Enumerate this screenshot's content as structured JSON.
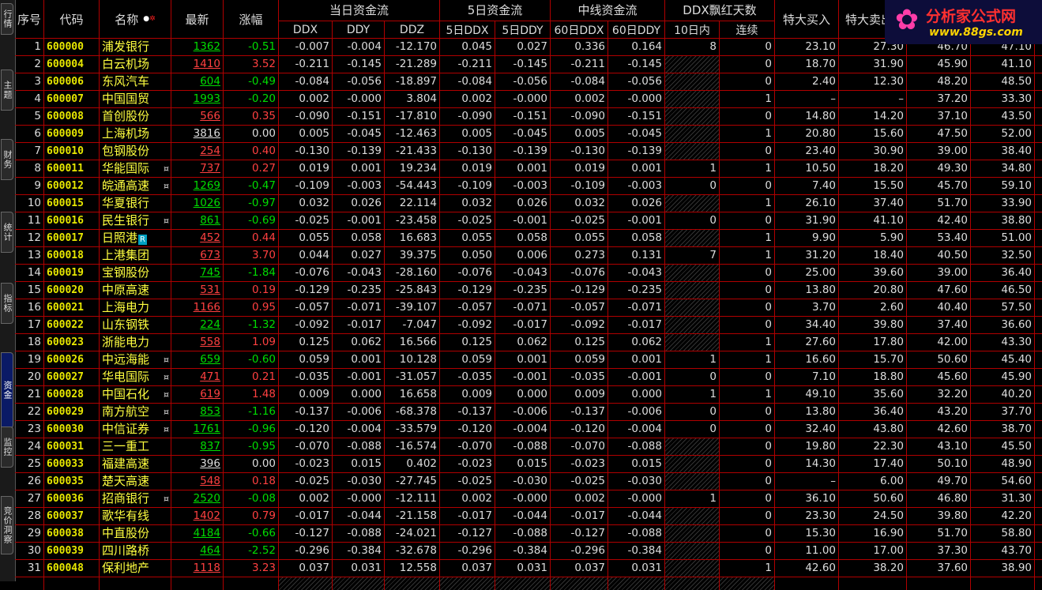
{
  "sidebar": {
    "tabs": [
      {
        "label": "行情",
        "active": false
      },
      {
        "label": "主题",
        "active": false
      },
      {
        "label": "财务",
        "active": false
      },
      {
        "label": "统计",
        "active": false
      },
      {
        "label": "指标",
        "active": false
      },
      {
        "label": "资金",
        "active": true
      },
      {
        "label": "监控",
        "active": false
      },
      {
        "label": "竞价洞察",
        "active": false
      }
    ]
  },
  "header": {
    "seq": "序号",
    "code": "代码",
    "name": "名称",
    "latest": "最新",
    "change": "涨幅",
    "group_today": "当日资金流",
    "group_5d": "5日资金流",
    "group_mid": "中线资金流",
    "group_red": "DDX飘红天数",
    "big_buy": "特大买入",
    "big_sell": "特大卖出",
    "ddx": "DDX",
    "ddy": "DDY",
    "ddz": "DDZ",
    "ddx5": "5日DDX",
    "ddy5": "5日DDY",
    "ddx60": "60日DDX",
    "ddy60": "60日DDY",
    "red10": "10日内",
    "streak": "连续"
  },
  "logo": {
    "title": "分析家公式网",
    "url": "www.88gs.com"
  },
  "colors": {
    "grid": "#b00000",
    "up": "#ff4040",
    "down": "#00dd00",
    "code": "#e8e800",
    "name": "#ffff40"
  },
  "rows": [
    {
      "seq": "1",
      "code": "600000",
      "name": "浦发银行",
      "sym": "",
      "price": "1362",
      "change": "-0.51",
      "ddx": "-0.007",
      "ddy": "-0.004",
      "ddz": "-12.170",
      "ddx5": "0.045",
      "ddy5": "0.027",
      "ddx60": "0.336",
      "ddy60": "0.164",
      "red10": "8",
      "streak": "0",
      "buy": "23.10",
      "sell": "27.30",
      "c1": "46.70",
      "c2": "47.10"
    },
    {
      "seq": "2",
      "code": "600004",
      "name": "白云机场",
      "sym": "",
      "price": "1410",
      "change": "3.52",
      "ddx": "-0.211",
      "ddy": "-0.145",
      "ddz": "-21.289",
      "ddx5": "-0.211",
      "ddy5": "-0.145",
      "ddx60": "-0.211",
      "ddy60": "-0.145",
      "red10": "",
      "streak": "0",
      "buy": "18.70",
      "sell": "31.90",
      "c1": "45.90",
      "c2": "41.10"
    },
    {
      "seq": "3",
      "code": "600006",
      "name": "东风汽车",
      "sym": "",
      "price": "604",
      "change": "-0.49",
      "ddx": "-0.084",
      "ddy": "-0.056",
      "ddz": "-18.897",
      "ddx5": "-0.084",
      "ddy5": "-0.056",
      "ddx60": "-0.084",
      "ddy60": "-0.056",
      "red10": "",
      "streak": "0",
      "buy": "2.40",
      "sell": "12.30",
      "c1": "48.20",
      "c2": "48.50"
    },
    {
      "seq": "4",
      "code": "600007",
      "name": "中国国贸",
      "sym": "",
      "price": "1993",
      "change": "-0.20",
      "ddx": "0.002",
      "ddy": "-0.000",
      "ddz": "3.804",
      "ddx5": "0.002",
      "ddy5": "-0.000",
      "ddx60": "0.002",
      "ddy60": "-0.000",
      "red10": "",
      "streak": "1",
      "buy": "–",
      "sell": "–",
      "c1": "37.20",
      "c2": "33.30"
    },
    {
      "seq": "5",
      "code": "600008",
      "name": "首创股份",
      "sym": "",
      "price": "566",
      "change": "0.35",
      "ddx": "-0.090",
      "ddy": "-0.151",
      "ddz": "-17.810",
      "ddx5": "-0.090",
      "ddy5": "-0.151",
      "ddx60": "-0.090",
      "ddy60": "-0.151",
      "red10": "",
      "streak": "0",
      "buy": "14.80",
      "sell": "14.20",
      "c1": "37.10",
      "c2": "43.50"
    },
    {
      "seq": "6",
      "code": "600009",
      "name": "上海机场",
      "sym": "",
      "price": "3816",
      "change": "0.00",
      "ddx": "0.005",
      "ddy": "-0.045",
      "ddz": "-12.463",
      "ddx5": "0.005",
      "ddy5": "-0.045",
      "ddx60": "0.005",
      "ddy60": "-0.045",
      "red10": "",
      "streak": "1",
      "buy": "20.80",
      "sell": "15.60",
      "c1": "47.50",
      "c2": "52.00"
    },
    {
      "seq": "7",
      "code": "600010",
      "name": "包钢股份",
      "sym": "",
      "price": "254",
      "change": "0.40",
      "ddx": "-0.130",
      "ddy": "-0.139",
      "ddz": "-21.433",
      "ddx5": "-0.130",
      "ddy5": "-0.139",
      "ddx60": "-0.130",
      "ddy60": "-0.139",
      "red10": "",
      "streak": "0",
      "buy": "23.40",
      "sell": "30.90",
      "c1": "39.00",
      "c2": "38.40"
    },
    {
      "seq": "8",
      "code": "600011",
      "name": "华能国际",
      "sym": "¤",
      "price": "737",
      "change": "0.27",
      "ddx": "0.019",
      "ddy": "0.001",
      "ddz": "19.234",
      "ddx5": "0.019",
      "ddy5": "0.001",
      "ddx60": "0.019",
      "ddy60": "0.001",
      "red10": "1",
      "streak": "1",
      "buy": "10.50",
      "sell": "18.20",
      "c1": "49.30",
      "c2": "34.80"
    },
    {
      "seq": "9",
      "code": "600012",
      "name": "皖通高速",
      "sym": "¤",
      "price": "1269",
      "change": "-0.47",
      "ddx": "-0.109",
      "ddy": "-0.003",
      "ddz": "-54.443",
      "ddx5": "-0.109",
      "ddy5": "-0.003",
      "ddx60": "-0.109",
      "ddy60": "-0.003",
      "red10": "0",
      "streak": "0",
      "buy": "7.40",
      "sell": "15.50",
      "c1": "45.70",
      "c2": "59.10"
    },
    {
      "seq": "10",
      "code": "600015",
      "name": "华夏银行",
      "sym": "",
      "price": "1026",
      "change": "-0.97",
      "ddx": "0.032",
      "ddy": "0.026",
      "ddz": "22.114",
      "ddx5": "0.032",
      "ddy5": "0.026",
      "ddx60": "0.032",
      "ddy60": "0.026",
      "red10": "",
      "streak": "1",
      "buy": "26.10",
      "sell": "37.40",
      "c1": "51.70",
      "c2": "33.90"
    },
    {
      "seq": "11",
      "code": "600016",
      "name": "民生银行",
      "sym": "¤",
      "price": "861",
      "change": "-0.69",
      "ddx": "-0.025",
      "ddy": "-0.001",
      "ddz": "-23.458",
      "ddx5": "-0.025",
      "ddy5": "-0.001",
      "ddx60": "-0.025",
      "ddy60": "-0.001",
      "red10": "0",
      "streak": "0",
      "buy": "31.90",
      "sell": "41.10",
      "c1": "42.40",
      "c2": "38.80"
    },
    {
      "seq": "12",
      "code": "600017",
      "name": "日照港",
      "sym": "R",
      "price": "452",
      "change": "0.44",
      "ddx": "0.055",
      "ddy": "0.058",
      "ddz": "16.683",
      "ddx5": "0.055",
      "ddy5": "0.058",
      "ddx60": "0.055",
      "ddy60": "0.058",
      "red10": "",
      "streak": "1",
      "buy": "9.90",
      "sell": "5.90",
      "c1": "53.40",
      "c2": "51.00"
    },
    {
      "seq": "13",
      "code": "600018",
      "name": "上港集团",
      "sym": "",
      "price": "673",
      "change": "3.70",
      "ddx": "0.044",
      "ddy": "0.027",
      "ddz": "39.375",
      "ddx5": "0.050",
      "ddy5": "0.006",
      "ddx60": "0.273",
      "ddy60": "0.131",
      "red10": "7",
      "streak": "1",
      "buy": "31.20",
      "sell": "18.40",
      "c1": "40.50",
      "c2": "32.50"
    },
    {
      "seq": "14",
      "code": "600019",
      "name": "宝钢股份",
      "sym": "",
      "price": "745",
      "change": "-1.84",
      "ddx": "-0.076",
      "ddy": "-0.043",
      "ddz": "-28.160",
      "ddx5": "-0.076",
      "ddy5": "-0.043",
      "ddx60": "-0.076",
      "ddy60": "-0.043",
      "red10": "",
      "streak": "0",
      "buy": "25.00",
      "sell": "39.60",
      "c1": "39.00",
      "c2": "36.40"
    },
    {
      "seq": "15",
      "code": "600020",
      "name": "中原高速",
      "sym": "",
      "price": "531",
      "change": "0.19",
      "ddx": "-0.129",
      "ddy": "-0.235",
      "ddz": "-25.843",
      "ddx5": "-0.129",
      "ddy5": "-0.235",
      "ddx60": "-0.129",
      "ddy60": "-0.235",
      "red10": "",
      "streak": "0",
      "buy": "13.80",
      "sell": "20.80",
      "c1": "47.60",
      "c2": "46.50"
    },
    {
      "seq": "16",
      "code": "600021",
      "name": "上海电力",
      "sym": "",
      "price": "1166",
      "change": "0.95",
      "ddx": "-0.057",
      "ddy": "-0.071",
      "ddz": "-39.107",
      "ddx5": "-0.057",
      "ddy5": "-0.071",
      "ddx60": "-0.057",
      "ddy60": "-0.071",
      "red10": "",
      "streak": "0",
      "buy": "3.70",
      "sell": "2.60",
      "c1": "40.40",
      "c2": "57.50"
    },
    {
      "seq": "17",
      "code": "600022",
      "name": "山东钢铁",
      "sym": "",
      "price": "224",
      "change": "-1.32",
      "ddx": "-0.092",
      "ddy": "-0.017",
      "ddz": "-7.047",
      "ddx5": "-0.092",
      "ddy5": "-0.017",
      "ddx60": "-0.092",
      "ddy60": "-0.017",
      "red10": "",
      "streak": "0",
      "buy": "34.40",
      "sell": "39.80",
      "c1": "37.40",
      "c2": "36.60"
    },
    {
      "seq": "18",
      "code": "600023",
      "name": "浙能电力",
      "sym": "",
      "price": "558",
      "change": "1.09",
      "ddx": "0.125",
      "ddy": "0.062",
      "ddz": "16.566",
      "ddx5": "0.125",
      "ddy5": "0.062",
      "ddx60": "0.125",
      "ddy60": "0.062",
      "red10": "",
      "streak": "1",
      "buy": "27.60",
      "sell": "17.80",
      "c1": "42.00",
      "c2": "43.30"
    },
    {
      "seq": "19",
      "code": "600026",
      "name": "中远海能",
      "sym": "¤",
      "price": "659",
      "change": "-0.60",
      "ddx": "0.059",
      "ddy": "0.001",
      "ddz": "10.128",
      "ddx5": "0.059",
      "ddy5": "0.001",
      "ddx60": "0.059",
      "ddy60": "0.001",
      "red10": "1",
      "streak": "1",
      "buy": "16.60",
      "sell": "15.70",
      "c1": "50.60",
      "c2": "45.40"
    },
    {
      "seq": "20",
      "code": "600027",
      "name": "华电国际",
      "sym": "¤",
      "price": "471",
      "change": "0.21",
      "ddx": "-0.035",
      "ddy": "-0.001",
      "ddz": "-31.057",
      "ddx5": "-0.035",
      "ddy5": "-0.001",
      "ddx60": "-0.035",
      "ddy60": "-0.001",
      "red10": "0",
      "streak": "0",
      "buy": "7.10",
      "sell": "18.80",
      "c1": "45.60",
      "c2": "45.90"
    },
    {
      "seq": "21",
      "code": "600028",
      "name": "中国石化",
      "sym": "¤",
      "price": "619",
      "change": "1.48",
      "ddx": "0.009",
      "ddy": "0.000",
      "ddz": "16.658",
      "ddx5": "0.009",
      "ddy5": "0.000",
      "ddx60": "0.009",
      "ddy60": "0.000",
      "red10": "1",
      "streak": "1",
      "buy": "49.10",
      "sell": "35.60",
      "c1": "32.20",
      "c2": "40.20"
    },
    {
      "seq": "22",
      "code": "600029",
      "name": "南方航空",
      "sym": "¤",
      "price": "853",
      "change": "-1.16",
      "ddx": "-0.137",
      "ddy": "-0.006",
      "ddz": "-68.378",
      "ddx5": "-0.137",
      "ddy5": "-0.006",
      "ddx60": "-0.137",
      "ddy60": "-0.006",
      "red10": "0",
      "streak": "0",
      "buy": "13.80",
      "sell": "36.40",
      "c1": "43.20",
      "c2": "37.70"
    },
    {
      "seq": "23",
      "code": "600030",
      "name": "中信证券",
      "sym": "¤",
      "price": "1761",
      "change": "-0.96",
      "ddx": "-0.120",
      "ddy": "-0.004",
      "ddz": "-33.579",
      "ddx5": "-0.120",
      "ddy5": "-0.004",
      "ddx60": "-0.120",
      "ddy60": "-0.004",
      "red10": "0",
      "streak": "0",
      "buy": "32.40",
      "sell": "43.80",
      "c1": "42.60",
      "c2": "38.70"
    },
    {
      "seq": "24",
      "code": "600031",
      "name": "三一重工",
      "sym": "",
      "price": "837",
      "change": "-0.95",
      "ddx": "-0.070",
      "ddy": "-0.088",
      "ddz": "-16.574",
      "ddx5": "-0.070",
      "ddy5": "-0.088",
      "ddx60": "-0.070",
      "ddy60": "-0.088",
      "red10": "",
      "streak": "0",
      "buy": "19.80",
      "sell": "22.30",
      "c1": "43.10",
      "c2": "45.50"
    },
    {
      "seq": "25",
      "code": "600033",
      "name": "福建高速",
      "sym": "",
      "price": "396",
      "change": "0.00",
      "ddx": "-0.023",
      "ddy": "0.015",
      "ddz": "0.402",
      "ddx5": "-0.023",
      "ddy5": "0.015",
      "ddx60": "-0.023",
      "ddy60": "0.015",
      "red10": "",
      "streak": "0",
      "buy": "14.30",
      "sell": "17.40",
      "c1": "50.10",
      "c2": "48.90"
    },
    {
      "seq": "26",
      "code": "600035",
      "name": "楚天高速",
      "sym": "",
      "price": "548",
      "change": "0.18",
      "ddx": "-0.025",
      "ddy": "-0.030",
      "ddz": "-27.745",
      "ddx5": "-0.025",
      "ddy5": "-0.030",
      "ddx60": "-0.025",
      "ddy60": "-0.030",
      "red10": "",
      "streak": "0",
      "buy": "–",
      "sell": "6.00",
      "c1": "49.70",
      "c2": "54.60"
    },
    {
      "seq": "27",
      "code": "600036",
      "name": "招商银行",
      "sym": "¤",
      "price": "2520",
      "change": "-0.08",
      "ddx": "0.002",
      "ddy": "-0.000",
      "ddz": "-12.111",
      "ddx5": "0.002",
      "ddy5": "-0.000",
      "ddx60": "0.002",
      "ddy60": "-0.000",
      "red10": "1",
      "streak": "0",
      "buy": "36.10",
      "sell": "50.60",
      "c1": "46.80",
      "c2": "31.30"
    },
    {
      "seq": "28",
      "code": "600037",
      "name": "歌华有线",
      "sym": "",
      "price": "1402",
      "change": "0.79",
      "ddx": "-0.017",
      "ddy": "-0.044",
      "ddz": "-21.158",
      "ddx5": "-0.017",
      "ddy5": "-0.044",
      "ddx60": "-0.017",
      "ddy60": "-0.044",
      "red10": "",
      "streak": "0",
      "buy": "23.30",
      "sell": "24.50",
      "c1": "39.80",
      "c2": "42.20"
    },
    {
      "seq": "29",
      "code": "600038",
      "name": "中直股份",
      "sym": "",
      "price": "4184",
      "change": "-0.66",
      "ddx": "-0.127",
      "ddy": "-0.088",
      "ddz": "-24.021",
      "ddx5": "-0.127",
      "ddy5": "-0.088",
      "ddx60": "-0.127",
      "ddy60": "-0.088",
      "red10": "",
      "streak": "0",
      "buy": "15.30",
      "sell": "16.90",
      "c1": "51.70",
      "c2": "58.80"
    },
    {
      "seq": "30",
      "code": "600039",
      "name": "四川路桥",
      "sym": "",
      "price": "464",
      "change": "-2.52",
      "ddx": "-0.296",
      "ddy": "-0.384",
      "ddz": "-32.678",
      "ddx5": "-0.296",
      "ddy5": "-0.384",
      "ddx60": "-0.296",
      "ddy60": "-0.384",
      "red10": "",
      "streak": "0",
      "buy": "11.00",
      "sell": "17.00",
      "c1": "37.30",
      "c2": "43.70"
    },
    {
      "seq": "31",
      "code": "600048",
      "name": "保利地产",
      "sym": "",
      "price": "1118",
      "change": "3.23",
      "ddx": "0.037",
      "ddy": "0.031",
      "ddz": "12.558",
      "ddx5": "0.037",
      "ddy5": "0.031",
      "ddx60": "0.037",
      "ddy60": "0.031",
      "red10": "",
      "streak": "1",
      "buy": "42.60",
      "sell": "38.20",
      "c1": "37.60",
      "c2": "38.90"
    }
  ]
}
